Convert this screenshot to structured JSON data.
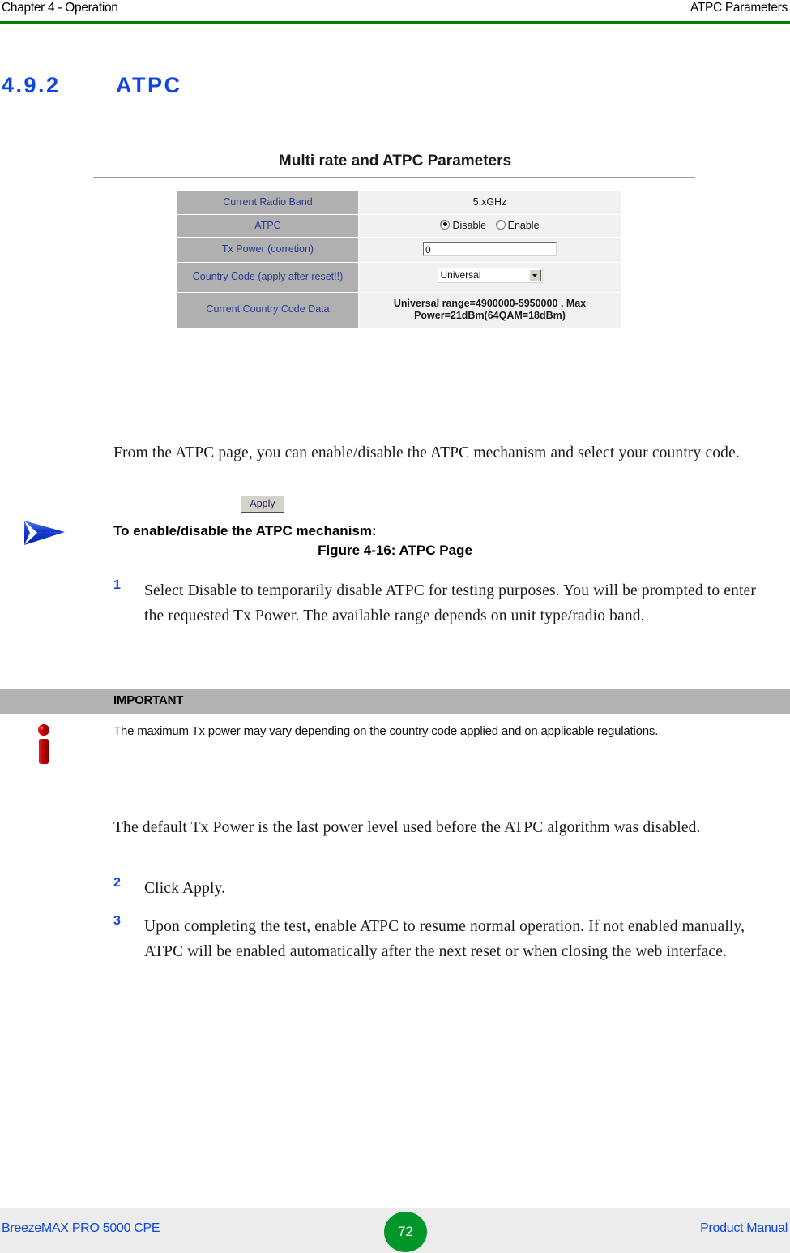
{
  "header": {
    "left": "Chapter 4 - Operation",
    "right": "ATPC Parameters",
    "rule_color": "#008000"
  },
  "section": {
    "number": "4.9.2",
    "title": "ATPC",
    "color": "#1046dc"
  },
  "figure": {
    "ui_title": "Multi rate and ATPC Parameters",
    "rows": [
      {
        "label": "Current Radio Band",
        "value": "5.xGHz",
        "control": "text"
      },
      {
        "label": "ATPC",
        "value": "",
        "control": "radio"
      },
      {
        "label": "Tx Power (corretion)",
        "value": "0",
        "control": "input"
      },
      {
        "label": "Country Code (apply after reset!!)",
        "value": "Universal",
        "control": "select"
      },
      {
        "label": "Current Country Code Data",
        "value": "Universal range=4900000-5950000 , Max Power=21dBm(64QAM=18dBm)",
        "control": "text"
      }
    ],
    "radio_options": [
      {
        "label": "Disable",
        "selected": true
      },
      {
        "label": "Enable",
        "selected": false
      }
    ],
    "apply_label": "Apply",
    "caption": "Figure 4-16: ATPC Page",
    "label_color": "#2c3a8c",
    "label_bg": "#b0b0b0",
    "value_bg": "#f1f1f1"
  },
  "body": {
    "intro": "From the ATPC page, you can enable/disable the ATPC mechanism and select your country code.",
    "procedure_heading": "To enable/disable the ATPC mechanism:",
    "steps": [
      {
        "num": "1",
        "text": "Select Disable to temporarily disable ATPC for testing purposes. You will be prompted to enter the requested Tx Power. The available range depends on unit type/radio band."
      },
      {
        "num": "2",
        "text": "Click Apply."
      },
      {
        "num": "3",
        "text": "Upon completing the test, enable ATPC to resume normal operation. If not enabled manually, ATPC will be enabled automatically after the next reset or when closing the web interface."
      }
    ],
    "default_power_note": "The default Tx Power is the last power level used before the ATPC algorithm was disabled."
  },
  "callout": {
    "title": "IMPORTANT",
    "text": "The maximum Tx power may vary depending on the country code applied and on applicable regulations.",
    "bar_color": "#b3b3b3",
    "icon_color": "#c00000"
  },
  "footer": {
    "left": "BreezeMAX PRO 5000 CPE",
    "page_number": "72",
    "right": "Product Manual",
    "badge_color": "#00962a",
    "text_color": "#1046dc"
  }
}
